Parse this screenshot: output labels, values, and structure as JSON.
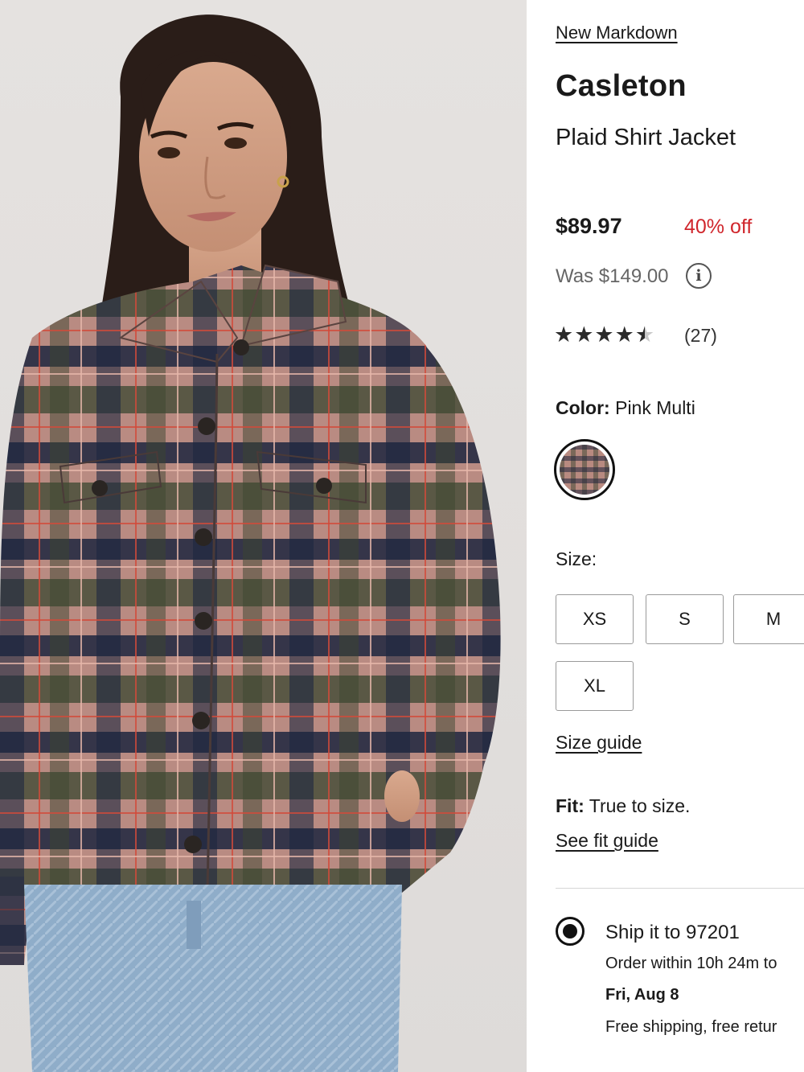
{
  "product_image": {
    "alt": "Model wearing plaid shirt jacket"
  },
  "product": {
    "badge": "New Markdown",
    "brand": "Casleton",
    "name": "Plaid Shirt Jacket",
    "price": "$89.97",
    "discount": "40% off",
    "was_price": "Was $149.00",
    "info_icon": "i",
    "rating": {
      "stars_full": "★★★★",
      "star_half": "★",
      "value": 4.5,
      "count": "(27)"
    }
  },
  "color": {
    "label": "Color:",
    "value": "Pink Multi"
  },
  "size": {
    "label": "Size:",
    "options": [
      "XS",
      "S",
      "M",
      "XL"
    ],
    "guide_link": "Size guide"
  },
  "fit": {
    "label": "Fit:",
    "value": "True to size.",
    "guide_link": "See fit guide"
  },
  "shipping": {
    "title": "Ship it to 97201",
    "order_within": "Order within 10h 24m to",
    "date": "Fri, Aug 8",
    "free": "Free shipping, free retur"
  },
  "colors": {
    "discount_red": "#d0262c",
    "text": "#1a1a1a",
    "muted": "#666666"
  }
}
